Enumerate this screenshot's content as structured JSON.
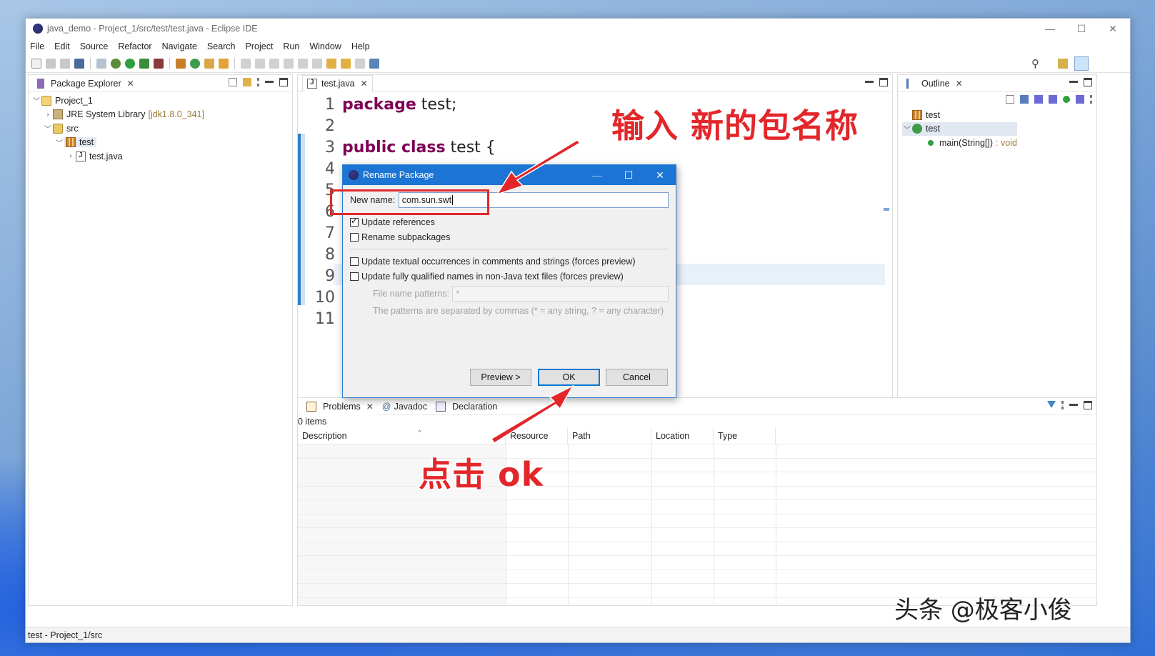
{
  "window": {
    "title": "java_demo - Project_1/src/test/test.java - Eclipse IDE"
  },
  "menu": [
    "File",
    "Edit",
    "Source",
    "Refactor",
    "Navigate",
    "Search",
    "Project",
    "Run",
    "Window",
    "Help"
  ],
  "package_explorer": {
    "tab_label": "Package Explorer",
    "tree": {
      "project": "Project_1",
      "jre_label": "JRE System Library",
      "jre_version": "[jdk1.8.0_341]",
      "src": "src",
      "package": "test",
      "file": "test.java"
    }
  },
  "editor": {
    "tab_label": "test.java",
    "line_numbers": [
      "1",
      "2",
      "3",
      "4",
      "5",
      "6",
      "7",
      "8",
      "9",
      "10",
      "11"
    ],
    "line1": {
      "kw": "package",
      "rest": " test;"
    },
    "line3": {
      "kw": "public class",
      "rest": " test {"
    },
    "line10": "}"
  },
  "outline": {
    "tab_label": "Outline",
    "items": {
      "package": "test",
      "class": "test",
      "method": "main(String[])",
      "method_type": ": void"
    }
  },
  "dialog": {
    "title": "Rename Package",
    "new_name_label": "New name:",
    "new_name_value": "com.sun.swt",
    "options": [
      {
        "label": "Update references",
        "checked": true
      },
      {
        "label": "Rename subpackages",
        "checked": false
      },
      {
        "label": "Update textual occurrences in comments and strings (forces preview)",
        "checked": false
      },
      {
        "label": "Update fully qualified names in non-Java text files (forces preview)",
        "checked": false
      }
    ],
    "file_patterns_label": "File name patterns:",
    "file_patterns_value": "*",
    "patterns_hint": "The patterns are separated by commas (* = any string, ? = any character)",
    "buttons": {
      "preview": "Preview >",
      "ok": "OK",
      "cancel": "Cancel"
    }
  },
  "bottom_panel": {
    "tabs": [
      "Problems",
      "Javadoc",
      "Declaration"
    ],
    "count": "0 items",
    "columns": [
      "Description",
      "Resource",
      "Path",
      "Location",
      "Type"
    ]
  },
  "status_bar": "test - Project_1/src",
  "annotations": {
    "top": "输入 新的包名称",
    "bottom": "点击 ok",
    "color": "#e3262a"
  },
  "watermark": "头条 @极客小俊"
}
